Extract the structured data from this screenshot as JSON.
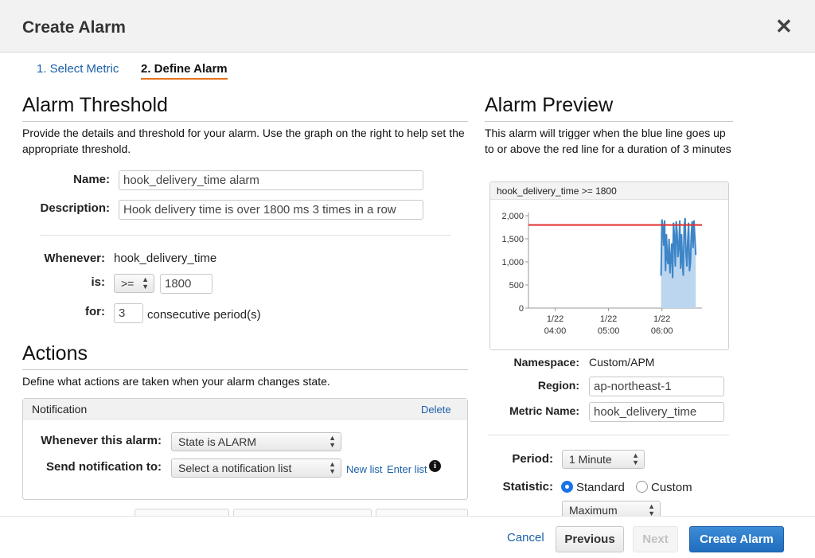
{
  "dialog": {
    "title": "Create Alarm"
  },
  "steps": [
    {
      "label": "1. Select Metric"
    },
    {
      "label": "2. Define Alarm"
    }
  ],
  "threshold": {
    "title": "Alarm Threshold",
    "description": "Provide the details and threshold for your alarm. Use the graph on the right to help set the appropriate threshold.",
    "name_label": "Name:",
    "name_value": "hook_delivery_time alarm",
    "description_label": "Description:",
    "description_value": "Hook delivery time is over 1800 ms 3 times in a row",
    "whenever_label": "Whenever:",
    "whenever_value": "hook_delivery_time",
    "is_label": "is:",
    "operator": ">=",
    "threshold_value": "1800",
    "for_label": "for:",
    "periods_value": "3",
    "periods_suffix": "consecutive period(s)"
  },
  "actions": {
    "title": "Actions",
    "description": "Define what actions are taken when your alarm changes state.",
    "notification": {
      "header": "Notification",
      "delete_label": "Delete",
      "whenever_label": "Whenever this alarm:",
      "state_value": "State is ALARM",
      "send_label": "Send notification to:",
      "list_placeholder": "Select a notification list",
      "new_list_label": "New list",
      "enter_list_label": "Enter list",
      "info_icon": "info-icon"
    }
  },
  "preview": {
    "title": "Alarm Preview",
    "description": "This alarm will trigger when the blue line goes up to or above the red line for a duration of 3 minutes",
    "chart_title": "hook_delivery_time >= 1800",
    "namespace_label": "Namespace:",
    "namespace_value": "Custom/APM",
    "region_label": "Region:",
    "region_value": "ap-northeast-1",
    "metric_label": "Metric Name:",
    "metric_value": "hook_delivery_time",
    "period_label": "Period:",
    "period_value": "1 Minute",
    "statistic_label": "Statistic:",
    "statistic_options": [
      "Standard",
      "Custom"
    ],
    "statistic_selected": "Standard",
    "statistic_value": "Maximum"
  },
  "chart_data": {
    "type": "area",
    "title": "hook_delivery_time >= 1800",
    "ylim": [
      0,
      2000
    ],
    "yticks": [
      {
        "value": 2000,
        "label": "2,000"
      },
      {
        "value": 1500,
        "label": "1,500"
      },
      {
        "value": 1000,
        "label": "1,000"
      },
      {
        "value": 500,
        "label": "500"
      },
      {
        "value": 0,
        "label": "0"
      }
    ],
    "xticks": [
      {
        "line1": "1/22",
        "line2": "04:00"
      },
      {
        "line1": "1/22",
        "line2": "05:00"
      },
      {
        "line1": "1/22",
        "line2": "06:00"
      }
    ],
    "threshold": 1800,
    "threshold_color": "#e0312f",
    "series_color": "#3d85c6",
    "fill_color": "#bcd6f0",
    "x_range": [
      "03:30",
      "06:45"
    ],
    "series": [
      {
        "x": [
          "05:59",
          "06:00",
          "06:01",
          "06:02",
          "06:03",
          "06:04",
          "06:05",
          "06:06",
          "06:07",
          "06:08",
          "06:09",
          "06:10",
          "06:11",
          "06:12",
          "06:13",
          "06:14",
          "06:15",
          "06:16",
          "06:17",
          "06:18",
          "06:19",
          "06:20",
          "06:21",
          "06:22",
          "06:23",
          "06:24",
          "06:25",
          "06:26",
          "06:27",
          "06:28",
          "06:29",
          "06:30",
          "06:31",
          "06:32",
          "06:33",
          "06:34",
          "06:35",
          "06:36",
          "06:37",
          "06:38"
        ],
        "values": [
          700,
          1920,
          1750,
          1350,
          1900,
          800,
          1600,
          1050,
          950,
          1500,
          750,
          1100,
          1400,
          650,
          1850,
          1550,
          900,
          1880,
          1650,
          1100,
          1300,
          1900,
          850,
          1600,
          1000,
          700,
          1750,
          1950,
          1200,
          900,
          1450,
          1850,
          800,
          1000,
          1600,
          1880,
          1300,
          1900,
          1500,
          1150
        ]
      }
    ]
  },
  "footer": {
    "cancel_label": "Cancel",
    "previous_label": "Previous",
    "next_label": "Next",
    "create_label": "Create Alarm"
  },
  "colors": {
    "accent": "#e8731a",
    "link": "#1a5fa8",
    "primary": "#1f6dbd"
  }
}
